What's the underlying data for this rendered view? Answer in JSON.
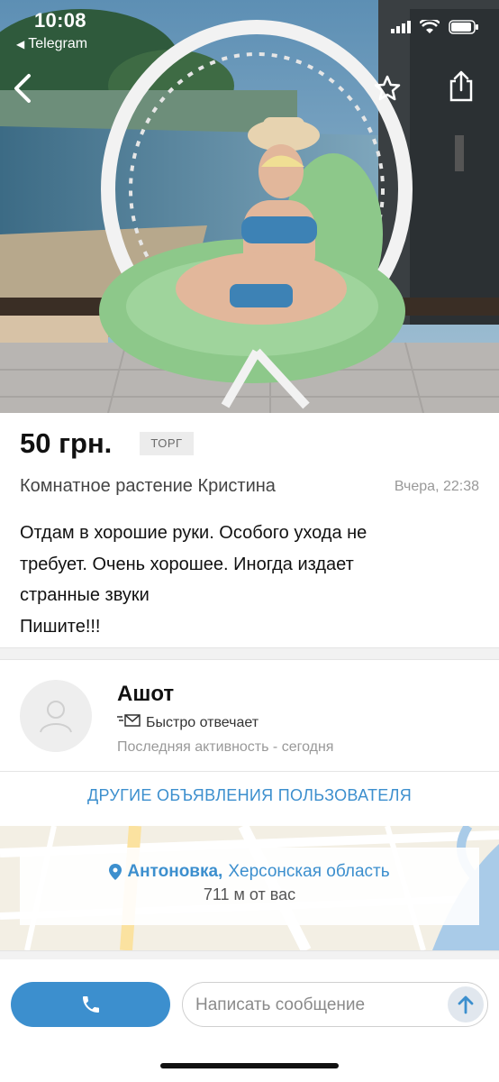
{
  "status_bar": {
    "time": "10:08",
    "back_app": "Telegram"
  },
  "nav": {
    "back_icon": "chevron-left-icon",
    "favorite_icon": "star-outline-icon",
    "share_icon": "share-icon"
  },
  "listing": {
    "price": "50 грн.",
    "negotiable_badge": "ТОРГ",
    "title": "Комнатное растение Кристина",
    "date": "Вчера, 22:38",
    "description_lines": [
      "Отдам в хорошие руки. Особого ухода не",
      "требует. Очень хорошее. Иногда издает",
      "странные звуки",
      "Пишите!!!"
    ]
  },
  "seller": {
    "name": "Ашот",
    "response_badge": "Быстро отвечает",
    "last_activity": "Последняя активность - сегодня",
    "other_ads_link": "ДРУГИЕ ОБЪЯВЛЕНИЯ ПОЛЬЗОВАТЕЛЯ"
  },
  "location": {
    "city": "Антоновка,",
    "region": "Херсонская область",
    "distance": "711 м от вас"
  },
  "bottom_bar": {
    "message_placeholder": "Написать сообщение"
  },
  "colors": {
    "accent": "#3c8fce",
    "badge_bg": "#ececec",
    "section_gap": "#f2f2f2"
  }
}
